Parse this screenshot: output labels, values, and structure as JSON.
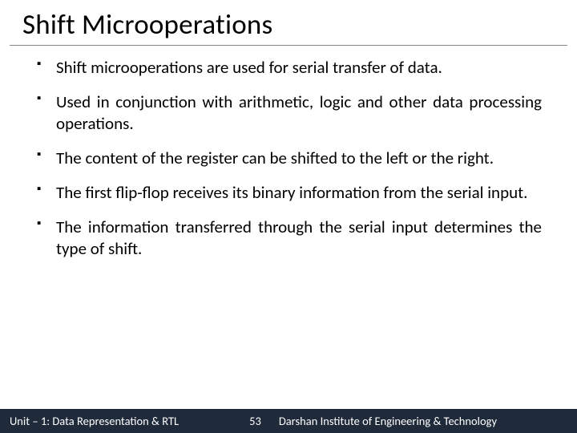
{
  "title": "Shift Microoperations",
  "bullets": [
    "Shift microoperations are used for serial transfer of data.",
    "Used in conjunction with arithmetic, logic and other data processing operations.",
    "The content of the register can be shifted to the left or the right.",
    "The first flip-flop receives its binary information from the serial input.",
    "The information transferred through the serial input determines the type of shift."
  ],
  "footer": {
    "left": "Unit – 1: Data Representation & RTL",
    "page": "53",
    "right": "Darshan Institute of Engineering & Technology"
  }
}
